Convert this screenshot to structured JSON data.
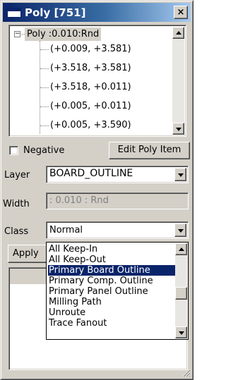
{
  "window": {
    "title": "Poly [751]",
    "close_label": "×"
  },
  "tree": {
    "root_label": "Poly :0.010:Rnd",
    "expander_symbol": "−",
    "points": [
      "(+0.009, +3.581)",
      "(+3.518, +3.581)",
      "(+3.518, +0.011)",
      "(+0.005, +0.011)",
      "(+0.005, +3.590)"
    ]
  },
  "negative": {
    "label": "Negative",
    "checked": false
  },
  "edit_button": {
    "label": "Edit Poly Item"
  },
  "layer": {
    "label": "Layer",
    "value": "BOARD_OUTLINE"
  },
  "width": {
    "label": "Width",
    "value": ": 0.010 : Rnd"
  },
  "class": {
    "label": "Class",
    "value": "Normal",
    "options": [
      "All Keep-In",
      "All Keep-Out",
      "Primary Board Outline",
      "Primary Comp. Outline",
      "Primary Panel Outline",
      "Milling Path",
      "Unroute",
      "Trace Fanout"
    ],
    "highlighted_index": 2
  },
  "apply_button": {
    "label": "Apply"
  },
  "colors": {
    "title_gradient_start": "#0a246a",
    "title_gradient_end": "#a6caf0",
    "face": "#d4d0c8",
    "selection": "#0a246a"
  }
}
